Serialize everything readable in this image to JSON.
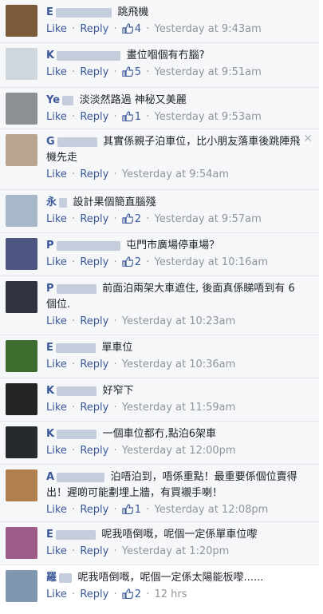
{
  "comments": [
    {
      "initial": "E",
      "text": "跳飛機",
      "blur_w": 70,
      "likes": "4",
      "time": "Yesterday at 9:43am"
    },
    {
      "initial": "K",
      "text": "畫位嗰個有冇腦?",
      "blur_w": 80,
      "likes": "5",
      "time": "Yesterday at 9:51am"
    },
    {
      "initial": "Ye",
      "text": "淡淡然路過 神秘又美麗",
      "blur_w": 14,
      "likes": "1",
      "time": "Yesterday at 9:53am"
    },
    {
      "initial": "G",
      "text": "其實係親子泊車位，比小朋友落車後跳陣飛機先走",
      "blur_w": 50,
      "likes": "",
      "time": "Yesterday at 9:54am"
    },
    {
      "initial": "永",
      "text": "設計果個簡直腦殘",
      "blur_w": 10,
      "likes": "2",
      "time": "Yesterday at 9:57am"
    },
    {
      "initial": "P",
      "text": "屯門市廣場停車場？",
      "blur_w": 80,
      "likes": "2",
      "time": "Yesterday at 10:16am"
    },
    {
      "initial": "P",
      "text": "前面泊兩架大車遮住, 後面真係睇唔到有 6 個位.",
      "blur_w": 50,
      "likes": "",
      "time": "Yesterday at 10:23am"
    },
    {
      "initial": "E",
      "text": "單車位",
      "blur_w": 50,
      "likes": "",
      "time": "Yesterday at 10:36am"
    },
    {
      "initial": "K",
      "text": "好窄下",
      "blur_w": 50,
      "likes": "",
      "time": "Yesterday at 11:59am"
    },
    {
      "initial": "K",
      "text": "一個車位都冇,點泊6架車",
      "blur_w": 50,
      "likes": "",
      "time": "Yesterday at 12:00pm"
    },
    {
      "initial": "A",
      "text": "泊唔泊到，唔係重點！最重要係個位賣得出！遲啲可能劃埋上牆，有買襯手喇！",
      "blur_w": 60,
      "likes": "1",
      "time": "Yesterday at 12:08pm"
    },
    {
      "initial": "E",
      "text": "呢我唔倒嘅，呢個一定係單車位嚟",
      "blur_w": 50,
      "likes": "",
      "time": "Yesterday at 1:20pm"
    },
    {
      "initial": "羅",
      "text": "呢我唔倒嘅，呢個一定係太陽能板嚟......",
      "blur_w": 16,
      "likes": "2",
      "time": "12 hrs"
    }
  ],
  "labels": {
    "like": "Like",
    "reply": "Reply",
    "dot": "·"
  },
  "avatars": [
    "#7a5a3a",
    "#cfd6dc",
    "#8c8f93",
    "#b8a58f",
    "#a7b9c9",
    "#4d5680",
    "#2f3440",
    "#3e6b2e",
    "#222426",
    "#26292d",
    "#b07f4f",
    "#9d5c88",
    "#7f98b0"
  ],
  "colors": {
    "link": "#3b5998",
    "muted": "#90949c",
    "text": "#1d2129"
  }
}
